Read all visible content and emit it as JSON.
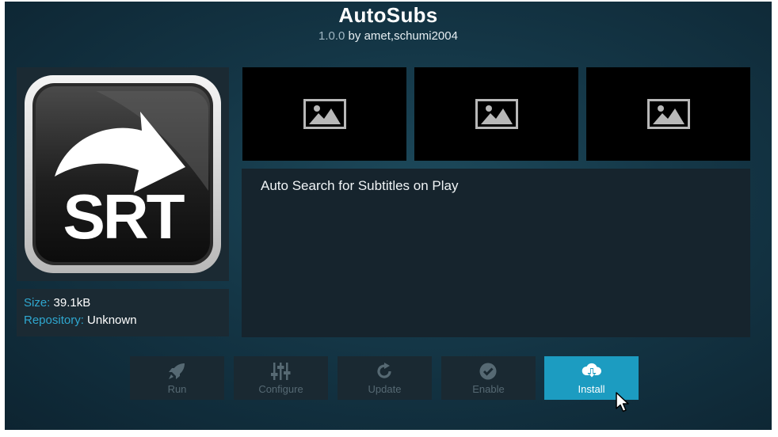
{
  "addon": {
    "name": "AutoSubs",
    "version": "1.0.0",
    "byline": " by amet,schumi2004",
    "logo_text": "SRT",
    "description": "Auto Search for Subtitles on Play"
  },
  "info": {
    "size_label": "Size:",
    "size_value": " 39.1kB",
    "repo_label": "Repository:",
    "repo_value": " Unknown"
  },
  "screenshots": [
    {
      "icon": "image-placeholder-icon"
    },
    {
      "icon": "image-placeholder-icon"
    },
    {
      "icon": "image-placeholder-icon"
    }
  ],
  "buttons": [
    {
      "label": "Run",
      "icon": "rocket-icon",
      "enabled": false
    },
    {
      "label": "Configure",
      "icon": "sliders-icon",
      "enabled": false
    },
    {
      "label": "Update",
      "icon": "refresh-icon",
      "enabled": false
    },
    {
      "label": "Enable",
      "icon": "check-circle-icon",
      "enabled": false
    },
    {
      "label": "Install",
      "icon": "cloud-download-icon",
      "enabled": true,
      "focused": true
    }
  ],
  "colors": {
    "accent": "#1c9cc1",
    "label_blue": "#2fa7cf",
    "background": "#143646",
    "panel": "#1b2a33",
    "disabled_text": "#566973"
  }
}
